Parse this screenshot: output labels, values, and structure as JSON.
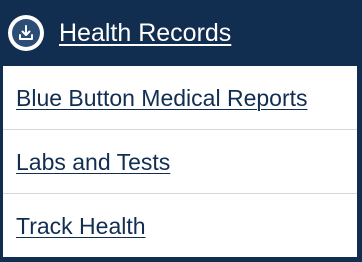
{
  "header": {
    "title": "Health Records",
    "icon": "download-icon"
  },
  "menu": {
    "items": [
      {
        "label": "Blue Button Medical Reports"
      },
      {
        "label": "Labs and Tests"
      },
      {
        "label": "Track Health"
      }
    ]
  },
  "colors": {
    "header_background": "#112e51",
    "link_text": "#112e51",
    "list_background": "#ffffff",
    "divider": "#d6d7d9"
  }
}
